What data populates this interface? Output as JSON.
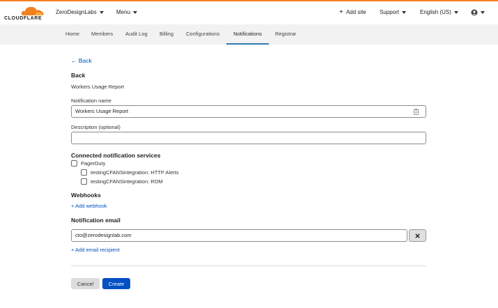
{
  "brand": {
    "logo_text": "CLOUDFLARE",
    "accent": "#f38020",
    "link_color": "#0051c3",
    "primary_button": "#0051c3"
  },
  "topnav": {
    "account": "ZeroDesignLabs",
    "menu": "Menu",
    "add_site": "Add site",
    "support": "Support",
    "language": "English (US)"
  },
  "tabs": [
    "Home",
    "Members",
    "Audit Log",
    "Billing",
    "Configurations",
    "Notifications",
    "Registrar"
  ],
  "page": {
    "back_link": "← Back",
    "heading": "Back",
    "subheading": "Workers Usage Report",
    "notification_name_label": "Notification name",
    "notification_name_value": "Workers Usage Report",
    "description_label": "Description (optional)",
    "description_value": "",
    "services_heading": "Connected notification services",
    "services": [
      {
        "label": "PagerDuty",
        "checked": false
      },
      {
        "label": "testingCFANSintegration: HTTP Alerts",
        "checked": false
      },
      {
        "label": "testingCFANSintegration: ROM",
        "checked": false
      }
    ],
    "webhooks_heading": "Webhooks",
    "add_webhook": "+ Add webhook",
    "email_heading": "Notification email",
    "email_value": "cto@zerodesignlab.com",
    "add_email": "+ Add email recipient",
    "cancel": "Cancel",
    "create": "Create"
  }
}
